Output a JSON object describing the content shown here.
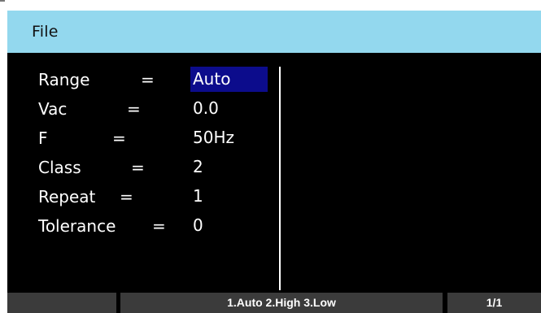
{
  "window": {
    "title": "File"
  },
  "params": [
    {
      "name": "Range",
      "value": "Auto",
      "selected": true
    },
    {
      "name": "Vac",
      "value": "0.0",
      "selected": false
    },
    {
      "name": "F",
      "value": "50Hz",
      "selected": false
    },
    {
      "name": "Class",
      "value": "2",
      "selected": false
    },
    {
      "name": "Repeat",
      "value": "1",
      "selected": false
    },
    {
      "name": "Tolerance",
      "value": "0",
      "selected": false
    }
  ],
  "equals_sign": "=",
  "softkeys": {
    "key1_label": "",
    "options_label": "1.Auto 2.High 3.Low",
    "page_label": "1/1"
  },
  "colors": {
    "title_bar": "#93d8ee",
    "screen_background": "#000000",
    "selection_highlight": "#0c0c8c",
    "softkey_background": "#3b3b3b"
  }
}
